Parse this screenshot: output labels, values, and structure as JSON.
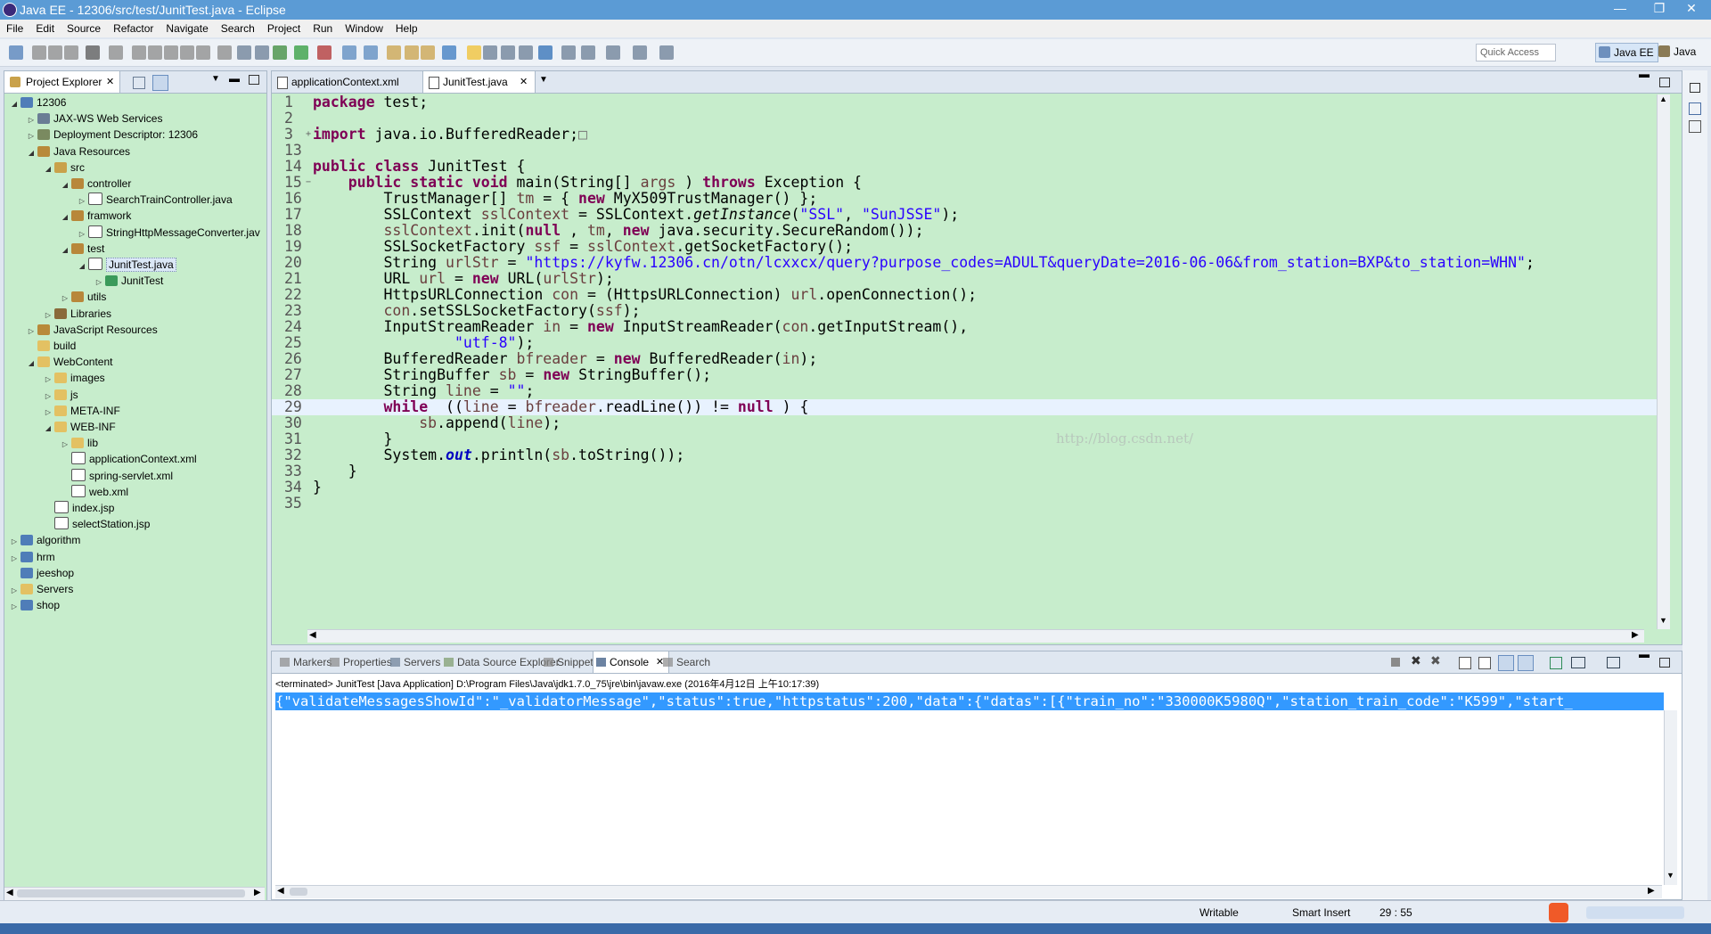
{
  "window": {
    "title": "Java EE - 12306/src/test/JunitTest.java - Eclipse",
    "controls": [
      "—",
      "❐",
      "✕"
    ]
  },
  "menu": [
    "File",
    "Edit",
    "Source",
    "Refactor",
    "Navigate",
    "Search",
    "Project",
    "Run",
    "Window",
    "Help"
  ],
  "toolbar": {
    "quick_access": "Quick Access",
    "perspectives": [
      "Java EE",
      "Java"
    ]
  },
  "explorer": {
    "tab_label": "Project Explorer",
    "tree": [
      {
        "label": "12306",
        "depth": 0,
        "twisty": "open",
        "icon": "project-icon"
      },
      {
        "label": "JAX-WS Web Services",
        "depth": 1,
        "twisty": "closed",
        "icon": "webservice-icon"
      },
      {
        "label": "Deployment Descriptor: 12306",
        "depth": 1,
        "twisty": "closed",
        "icon": "descriptor-icon"
      },
      {
        "label": "Java Resources",
        "depth": 1,
        "twisty": "open",
        "icon": "java-resources-icon"
      },
      {
        "label": "src",
        "depth": 2,
        "twisty": "open",
        "icon": "source-folder-icon"
      },
      {
        "label": "controller",
        "depth": 3,
        "twisty": "open",
        "icon": "package-icon"
      },
      {
        "label": "SearchTrainController.java",
        "depth": 4,
        "twisty": "closed",
        "icon": "java-file-icon"
      },
      {
        "label": "framwork",
        "depth": 3,
        "twisty": "open",
        "icon": "package-icon"
      },
      {
        "label": "StringHttpMessageConverter.jav",
        "depth": 4,
        "twisty": "closed",
        "icon": "java-file-icon"
      },
      {
        "label": "test",
        "depth": 3,
        "twisty": "open",
        "icon": "package-icon"
      },
      {
        "label": "JunitTest.java",
        "depth": 4,
        "twisty": "open",
        "icon": "java-file-icon",
        "selected": true
      },
      {
        "label": "JunitTest",
        "depth": 5,
        "twisty": "closed",
        "icon": "class-icon"
      },
      {
        "label": "utils",
        "depth": 3,
        "twisty": "closed",
        "icon": "package-icon"
      },
      {
        "label": "Libraries",
        "depth": 2,
        "twisty": "closed",
        "icon": "library-icon"
      },
      {
        "label": "JavaScript Resources",
        "depth": 1,
        "twisty": "closed",
        "icon": "js-resources-icon"
      },
      {
        "label": "build",
        "depth": 1,
        "twisty": "none",
        "icon": "folder-icon"
      },
      {
        "label": "WebContent",
        "depth": 1,
        "twisty": "open",
        "icon": "folder-icon"
      },
      {
        "label": "images",
        "depth": 2,
        "twisty": "closed",
        "icon": "folder-icon"
      },
      {
        "label": "js",
        "depth": 2,
        "twisty": "closed",
        "icon": "folder-icon"
      },
      {
        "label": "META-INF",
        "depth": 2,
        "twisty": "closed",
        "icon": "folder-icon"
      },
      {
        "label": "WEB-INF",
        "depth": 2,
        "twisty": "open",
        "icon": "folder-icon"
      },
      {
        "label": "lib",
        "depth": 3,
        "twisty": "closed",
        "icon": "folder-icon"
      },
      {
        "label": "applicationContext.xml",
        "depth": 3,
        "twisty": "none",
        "icon": "xml-file-icon"
      },
      {
        "label": "spring-servlet.xml",
        "depth": 3,
        "twisty": "none",
        "icon": "xml-file-icon"
      },
      {
        "label": "web.xml",
        "depth": 3,
        "twisty": "none",
        "icon": "xml-file-icon"
      },
      {
        "label": "index.jsp",
        "depth": 2,
        "twisty": "none",
        "icon": "jsp-file-icon"
      },
      {
        "label": "selectStation.jsp",
        "depth": 2,
        "twisty": "none",
        "icon": "jsp-file-icon"
      },
      {
        "label": "algorithm",
        "depth": 0,
        "twisty": "closed",
        "icon": "project-icon"
      },
      {
        "label": "hrm",
        "depth": 0,
        "twisty": "closed",
        "icon": "project-icon"
      },
      {
        "label": "jeeshop",
        "depth": 0,
        "twisty": "none",
        "icon": "project-icon"
      },
      {
        "label": "Servers",
        "depth": 0,
        "twisty": "closed",
        "icon": "folder-icon"
      },
      {
        "label": "shop",
        "depth": 0,
        "twisty": "closed",
        "icon": "project-icon"
      }
    ]
  },
  "editor": {
    "tabs": [
      {
        "label": "applicationContext.xml",
        "active": false
      },
      {
        "label": "JunitTest.java",
        "active": true
      }
    ],
    "current_line": "29",
    "watermark": "http://blog.csdn.net/",
    "lines": [
      {
        "n": "1",
        "fold": "",
        "tokens": [
          [
            "kw",
            "package"
          ],
          [
            "",
            "test;"
          ]
        ]
      },
      {
        "n": "2",
        "fold": "",
        "tokens": []
      },
      {
        "n": "3",
        "fold": "+",
        "tokens": [
          [
            "kw",
            "import"
          ],
          [
            "",
            "java.io.BufferedReader;"
          ],
          [
            "box",
            "□"
          ]
        ]
      },
      {
        "n": "13",
        "fold": "",
        "tokens": []
      },
      {
        "n": "14",
        "fold": "",
        "tokens": [
          [
            "kw",
            "public"
          ],
          [
            "kw",
            "class"
          ],
          [
            "",
            "JunitTest {"
          ]
        ]
      },
      {
        "n": "15",
        "fold": "−",
        "tokens": [
          [
            "",
            "    "
          ],
          [
            "kw",
            "public"
          ],
          [
            "kw",
            "static"
          ],
          [
            "kw",
            "void"
          ],
          [
            "",
            "main(String[] "
          ],
          [
            "var",
            "args"
          ],
          [
            "",
            " ) "
          ],
          [
            "kw",
            "throws"
          ],
          [
            "",
            "Exception {"
          ]
        ]
      },
      {
        "n": "16",
        "fold": "",
        "tokens": [
          [
            "",
            "        TrustManager[] "
          ],
          [
            "var",
            "tm"
          ],
          [
            "",
            " = { "
          ],
          [
            "kw",
            "new"
          ],
          [
            "",
            "MyX509TrustManager() };"
          ]
        ]
      },
      {
        "n": "17",
        "fold": "",
        "tokens": [
          [
            "",
            "        SSLContext "
          ],
          [
            "var",
            "sslContext"
          ],
          [
            "",
            " = SSLContext."
          ],
          [
            "it",
            "getInstance"
          ],
          [
            "",
            "("
          ],
          [
            "str",
            "\"SSL\""
          ],
          [
            "",
            ", "
          ],
          [
            "str",
            "\"SunJSSE\""
          ],
          [
            "",
            ");"
          ]
        ]
      },
      {
        "n": "18",
        "fold": "",
        "tokens": [
          [
            "",
            "        "
          ],
          [
            "var",
            "sslContext"
          ],
          [
            "",
            ".init("
          ],
          [
            "kw",
            "null"
          ],
          [
            "",
            ", "
          ],
          [
            "var",
            "tm"
          ],
          [
            "",
            ", "
          ],
          [
            "kw",
            "new"
          ],
          [
            "",
            "java.security.SecureRandom());"
          ]
        ]
      },
      {
        "n": "19",
        "fold": "",
        "tokens": [
          [
            "",
            "        SSLSocketFactory "
          ],
          [
            "var",
            "ssf"
          ],
          [
            "",
            " = "
          ],
          [
            "var",
            "sslContext"
          ],
          [
            "",
            ".getSocketFactory();"
          ]
        ]
      },
      {
        "n": "20",
        "fold": "",
        "tokens": [
          [
            "",
            "        String "
          ],
          [
            "var",
            "urlStr"
          ],
          [
            "",
            " = "
          ],
          [
            "str",
            "\"https://kyfw.12306.cn/otn/lcxxcx/query?purpose_codes=ADULT&queryDate=2016-06-06&from_station=BXP&to_station=WHN\""
          ],
          [
            "",
            ";"
          ]
        ]
      },
      {
        "n": "21",
        "fold": "",
        "tokens": [
          [
            "",
            "        URL "
          ],
          [
            "var",
            "url"
          ],
          [
            "",
            " = "
          ],
          [
            "kw",
            "new"
          ],
          [
            "",
            "URL("
          ],
          [
            "var",
            "urlStr"
          ],
          [
            "",
            ");"
          ]
        ]
      },
      {
        "n": "22",
        "fold": "",
        "tokens": [
          [
            "",
            "        HttpsURLConnection "
          ],
          [
            "var",
            "con"
          ],
          [
            "",
            " = (HttpsURLConnection) "
          ],
          [
            "var",
            "url"
          ],
          [
            "",
            ".openConnection();"
          ]
        ]
      },
      {
        "n": "23",
        "fold": "",
        "tokens": [
          [
            "",
            "        "
          ],
          [
            "var",
            "con"
          ],
          [
            "",
            ".setSSLSocketFactory("
          ],
          [
            "var",
            "ssf"
          ],
          [
            "",
            ");"
          ]
        ]
      },
      {
        "n": "24",
        "fold": "",
        "tokens": [
          [
            "",
            "        InputStreamReader "
          ],
          [
            "var",
            "in"
          ],
          [
            "",
            " = "
          ],
          [
            "kw",
            "new"
          ],
          [
            "",
            "InputStreamReader("
          ],
          [
            "var",
            "con"
          ],
          [
            "",
            ".getInputStream(),"
          ]
        ]
      },
      {
        "n": "25",
        "fold": "",
        "tokens": [
          [
            "",
            "                "
          ],
          [
            "str",
            "\"utf-8\""
          ],
          [
            "",
            ");"
          ]
        ]
      },
      {
        "n": "26",
        "fold": "",
        "tokens": [
          [
            "",
            "        BufferedReader "
          ],
          [
            "var",
            "bfreader"
          ],
          [
            "",
            " = "
          ],
          [
            "kw",
            "new"
          ],
          [
            "",
            "BufferedReader("
          ],
          [
            "var",
            "in"
          ],
          [
            "",
            ");"
          ]
        ]
      },
      {
        "n": "27",
        "fold": "",
        "tokens": [
          [
            "",
            "        StringBuffer "
          ],
          [
            "var",
            "sb"
          ],
          [
            "",
            " = "
          ],
          [
            "kw",
            "new"
          ],
          [
            "",
            "StringBuffer();"
          ]
        ]
      },
      {
        "n": "28",
        "fold": "",
        "tokens": [
          [
            "",
            "        String "
          ],
          [
            "var",
            "line"
          ],
          [
            "",
            " = "
          ],
          [
            "str",
            "\"\""
          ],
          [
            "",
            ";"
          ]
        ]
      },
      {
        "n": "29",
        "fold": "",
        "tokens": [
          [
            "",
            "        "
          ],
          [
            "kw",
            "while"
          ],
          [
            "",
            " (("
          ],
          [
            "var",
            "line"
          ],
          [
            "",
            " = "
          ],
          [
            "var",
            "bfreader"
          ],
          [
            "",
            ".readLine()) != "
          ],
          [
            "kw",
            "null"
          ],
          [
            "",
            ") {"
          ]
        ]
      },
      {
        "n": "30",
        "fold": "",
        "tokens": [
          [
            "",
            "            "
          ],
          [
            "var",
            "sb"
          ],
          [
            "",
            ".append("
          ],
          [
            "var",
            "line"
          ],
          [
            "",
            ");"
          ]
        ]
      },
      {
        "n": "31",
        "fold": "",
        "tokens": [
          [
            "",
            "        }"
          ]
        ]
      },
      {
        "n": "32",
        "fold": "",
        "tokens": [
          [
            "",
            "        System."
          ],
          [
            "outf",
            "out"
          ],
          [
            "",
            ".println("
          ],
          [
            "var",
            "sb"
          ],
          [
            "",
            ".toString());"
          ]
        ]
      },
      {
        "n": "33",
        "fold": "",
        "tokens": [
          [
            "",
            "    }"
          ]
        ]
      },
      {
        "n": "34",
        "fold": "",
        "tokens": [
          [
            "",
            "}"
          ]
        ]
      },
      {
        "n": "35",
        "fold": "",
        "tokens": []
      }
    ]
  },
  "console": {
    "tabs": [
      {
        "label": "Markers",
        "active": false,
        "icon": "markers-icon"
      },
      {
        "label": "Properties",
        "active": false,
        "icon": "properties-icon"
      },
      {
        "label": "Servers",
        "active": false,
        "icon": "servers-icon"
      },
      {
        "label": "Data Source Explorer",
        "active": false,
        "icon": "datasource-icon"
      },
      {
        "label": "Snippets",
        "active": false,
        "icon": "snippets-icon"
      },
      {
        "label": "Console",
        "active": true,
        "icon": "console-icon"
      },
      {
        "label": "Search",
        "active": false,
        "icon": "search-icon"
      }
    ],
    "header": "<terminated> JunitTest [Java Application] D:\\Program Files\\Java\\jdk1.7.0_75\\jre\\bin\\javaw.exe (2016年4月12日 上午10:17:39)",
    "output": "{\"validateMessagesShowId\":\"_validatorMessage\",\"status\":true,\"httpstatus\":200,\"data\":{\"datas\":[{\"train_no\":\"330000K5980Q\",\"station_train_code\":\"K599\",\"start_"
  },
  "status": {
    "writable": "Writable",
    "insert_mode": "Smart Insert",
    "position": "29 : 55"
  },
  "colors": {
    "editor_bg": "#c7edcc",
    "keyword": "#7f0055",
    "string": "#2a00ff",
    "variable": "#6a3e3e",
    "selection": "#3399ff",
    "titlebar": "#5b9bd5"
  }
}
